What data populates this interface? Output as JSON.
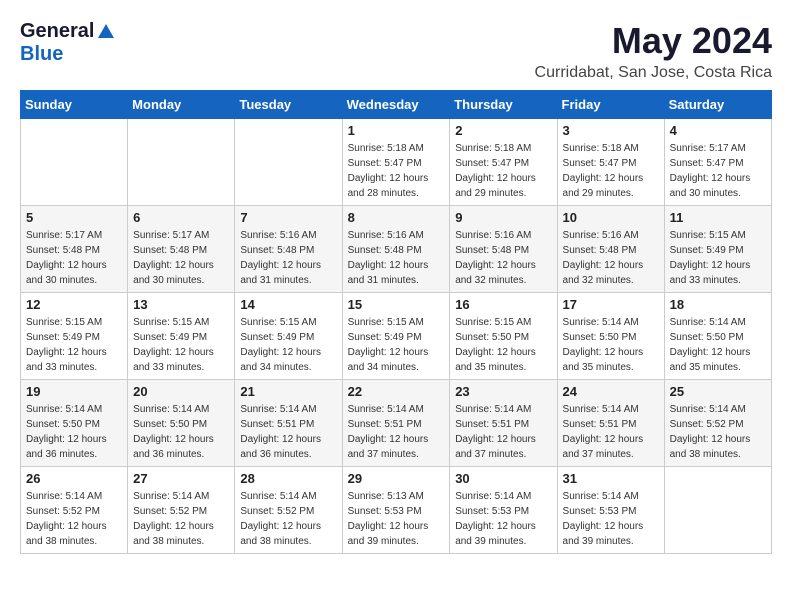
{
  "logo": {
    "general": "General",
    "blue": "Blue"
  },
  "title": {
    "month_year": "May 2024",
    "location": "Curridabat, San Jose, Costa Rica"
  },
  "weekdays": [
    "Sunday",
    "Monday",
    "Tuesday",
    "Wednesday",
    "Thursday",
    "Friday",
    "Saturday"
  ],
  "weeks": [
    [
      {
        "day": "",
        "sunrise": "",
        "sunset": "",
        "daylight": ""
      },
      {
        "day": "",
        "sunrise": "",
        "sunset": "",
        "daylight": ""
      },
      {
        "day": "",
        "sunrise": "",
        "sunset": "",
        "daylight": ""
      },
      {
        "day": "1",
        "sunrise": "Sunrise: 5:18 AM",
        "sunset": "Sunset: 5:47 PM",
        "daylight": "Daylight: 12 hours and 28 minutes."
      },
      {
        "day": "2",
        "sunrise": "Sunrise: 5:18 AM",
        "sunset": "Sunset: 5:47 PM",
        "daylight": "Daylight: 12 hours and 29 minutes."
      },
      {
        "day": "3",
        "sunrise": "Sunrise: 5:18 AM",
        "sunset": "Sunset: 5:47 PM",
        "daylight": "Daylight: 12 hours and 29 minutes."
      },
      {
        "day": "4",
        "sunrise": "Sunrise: 5:17 AM",
        "sunset": "Sunset: 5:47 PM",
        "daylight": "Daylight: 12 hours and 30 minutes."
      }
    ],
    [
      {
        "day": "5",
        "sunrise": "Sunrise: 5:17 AM",
        "sunset": "Sunset: 5:48 PM",
        "daylight": "Daylight: 12 hours and 30 minutes."
      },
      {
        "day": "6",
        "sunrise": "Sunrise: 5:17 AM",
        "sunset": "Sunset: 5:48 PM",
        "daylight": "Daylight: 12 hours and 30 minutes."
      },
      {
        "day": "7",
        "sunrise": "Sunrise: 5:16 AM",
        "sunset": "Sunset: 5:48 PM",
        "daylight": "Daylight: 12 hours and 31 minutes."
      },
      {
        "day": "8",
        "sunrise": "Sunrise: 5:16 AM",
        "sunset": "Sunset: 5:48 PM",
        "daylight": "Daylight: 12 hours and 31 minutes."
      },
      {
        "day": "9",
        "sunrise": "Sunrise: 5:16 AM",
        "sunset": "Sunset: 5:48 PM",
        "daylight": "Daylight: 12 hours and 32 minutes."
      },
      {
        "day": "10",
        "sunrise": "Sunrise: 5:16 AM",
        "sunset": "Sunset: 5:48 PM",
        "daylight": "Daylight: 12 hours and 32 minutes."
      },
      {
        "day": "11",
        "sunrise": "Sunrise: 5:15 AM",
        "sunset": "Sunset: 5:49 PM",
        "daylight": "Daylight: 12 hours and 33 minutes."
      }
    ],
    [
      {
        "day": "12",
        "sunrise": "Sunrise: 5:15 AM",
        "sunset": "Sunset: 5:49 PM",
        "daylight": "Daylight: 12 hours and 33 minutes."
      },
      {
        "day": "13",
        "sunrise": "Sunrise: 5:15 AM",
        "sunset": "Sunset: 5:49 PM",
        "daylight": "Daylight: 12 hours and 33 minutes."
      },
      {
        "day": "14",
        "sunrise": "Sunrise: 5:15 AM",
        "sunset": "Sunset: 5:49 PM",
        "daylight": "Daylight: 12 hours and 34 minutes."
      },
      {
        "day": "15",
        "sunrise": "Sunrise: 5:15 AM",
        "sunset": "Sunset: 5:49 PM",
        "daylight": "Daylight: 12 hours and 34 minutes."
      },
      {
        "day": "16",
        "sunrise": "Sunrise: 5:15 AM",
        "sunset": "Sunset: 5:50 PM",
        "daylight": "Daylight: 12 hours and 35 minutes."
      },
      {
        "day": "17",
        "sunrise": "Sunrise: 5:14 AM",
        "sunset": "Sunset: 5:50 PM",
        "daylight": "Daylight: 12 hours and 35 minutes."
      },
      {
        "day": "18",
        "sunrise": "Sunrise: 5:14 AM",
        "sunset": "Sunset: 5:50 PM",
        "daylight": "Daylight: 12 hours and 35 minutes."
      }
    ],
    [
      {
        "day": "19",
        "sunrise": "Sunrise: 5:14 AM",
        "sunset": "Sunset: 5:50 PM",
        "daylight": "Daylight: 12 hours and 36 minutes."
      },
      {
        "day": "20",
        "sunrise": "Sunrise: 5:14 AM",
        "sunset": "Sunset: 5:50 PM",
        "daylight": "Daylight: 12 hours and 36 minutes."
      },
      {
        "day": "21",
        "sunrise": "Sunrise: 5:14 AM",
        "sunset": "Sunset: 5:51 PM",
        "daylight": "Daylight: 12 hours and 36 minutes."
      },
      {
        "day": "22",
        "sunrise": "Sunrise: 5:14 AM",
        "sunset": "Sunset: 5:51 PM",
        "daylight": "Daylight: 12 hours and 37 minutes."
      },
      {
        "day": "23",
        "sunrise": "Sunrise: 5:14 AM",
        "sunset": "Sunset: 5:51 PM",
        "daylight": "Daylight: 12 hours and 37 minutes."
      },
      {
        "day": "24",
        "sunrise": "Sunrise: 5:14 AM",
        "sunset": "Sunset: 5:51 PM",
        "daylight": "Daylight: 12 hours and 37 minutes."
      },
      {
        "day": "25",
        "sunrise": "Sunrise: 5:14 AM",
        "sunset": "Sunset: 5:52 PM",
        "daylight": "Daylight: 12 hours and 38 minutes."
      }
    ],
    [
      {
        "day": "26",
        "sunrise": "Sunrise: 5:14 AM",
        "sunset": "Sunset: 5:52 PM",
        "daylight": "Daylight: 12 hours and 38 minutes."
      },
      {
        "day": "27",
        "sunrise": "Sunrise: 5:14 AM",
        "sunset": "Sunset: 5:52 PM",
        "daylight": "Daylight: 12 hours and 38 minutes."
      },
      {
        "day": "28",
        "sunrise": "Sunrise: 5:14 AM",
        "sunset": "Sunset: 5:52 PM",
        "daylight": "Daylight: 12 hours and 38 minutes."
      },
      {
        "day": "29",
        "sunrise": "Sunrise: 5:13 AM",
        "sunset": "Sunset: 5:53 PM",
        "daylight": "Daylight: 12 hours and 39 minutes."
      },
      {
        "day": "30",
        "sunrise": "Sunrise: 5:14 AM",
        "sunset": "Sunset: 5:53 PM",
        "daylight": "Daylight: 12 hours and 39 minutes."
      },
      {
        "day": "31",
        "sunrise": "Sunrise: 5:14 AM",
        "sunset": "Sunset: 5:53 PM",
        "daylight": "Daylight: 12 hours and 39 minutes."
      },
      {
        "day": "",
        "sunrise": "",
        "sunset": "",
        "daylight": ""
      }
    ]
  ]
}
